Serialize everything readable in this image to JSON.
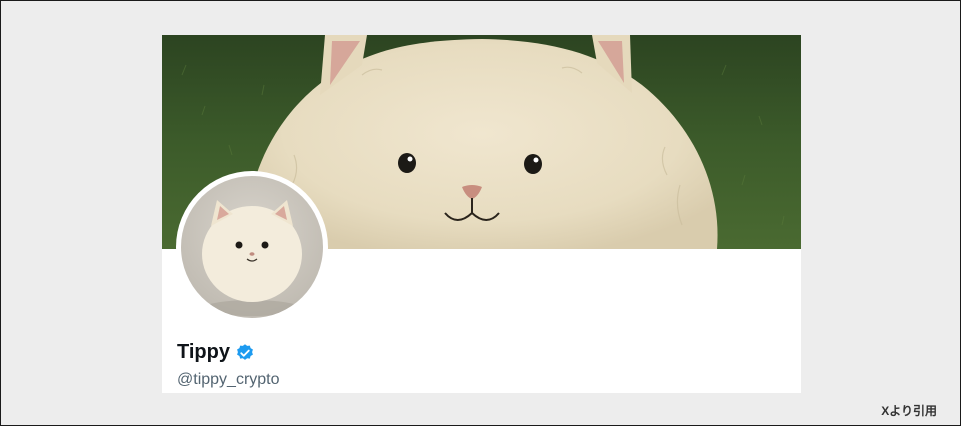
{
  "profile": {
    "display_name": "Tippy",
    "handle": "@tippy_crypto",
    "verified": true,
    "verified_badge_color": "#1d9bf0"
  },
  "icons": {
    "verified": "verified-check-badge-icon"
  },
  "credit": {
    "text": "Xより引用"
  },
  "colors": {
    "page_background": "#ededed",
    "card_background": "#ffffff",
    "name_color": "#0f1419",
    "handle_color": "#536471"
  }
}
